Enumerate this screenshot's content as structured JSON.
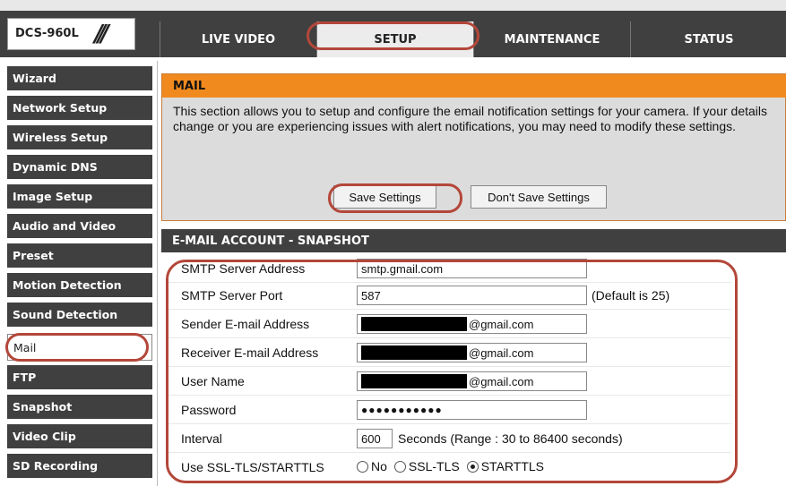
{
  "header": {
    "logo_text": "DCS-960L",
    "logo_slash": "///",
    "tabs": [
      {
        "label": "LIVE VIDEO"
      },
      {
        "label": "SETUP"
      },
      {
        "label": "MAINTENANCE"
      },
      {
        "label": "STATUS"
      }
    ],
    "active_tab": "SETUP"
  },
  "sidebar": {
    "items": [
      {
        "label": "Wizard"
      },
      {
        "label": "Network Setup"
      },
      {
        "label": "Wireless Setup"
      },
      {
        "label": "Dynamic DNS"
      },
      {
        "label": "Image Setup"
      },
      {
        "label": "Audio and Video"
      },
      {
        "label": "Preset"
      },
      {
        "label": "Motion Detection"
      },
      {
        "label": "Sound Detection"
      },
      {
        "label": "Mail"
      },
      {
        "label": "FTP"
      },
      {
        "label": "Snapshot"
      },
      {
        "label": "Video Clip"
      },
      {
        "label": "SD Recording"
      }
    ],
    "active_item": "Mail"
  },
  "mail": {
    "title": "MAIL",
    "description": "This section allows you to setup and configure the email notification settings for your camera. If your details change or you are experiencing issues with alert notifications, you may need to modify these settings.",
    "save_label": "Save Settings",
    "dont_save_label": "Don't Save Settings"
  },
  "account": {
    "title": "E-MAIL ACCOUNT - SNAPSHOT",
    "smtp_server_label": "SMTP Server Address",
    "smtp_server_value": "smtp.gmail.com",
    "smtp_port_label": "SMTP Server Port",
    "smtp_port_value": "587",
    "smtp_port_hint": "(Default is 25)",
    "sender_label": "Sender E-mail Address",
    "sender_suffix": "@gmail.com",
    "receiver_label": "Receiver E-mail Address",
    "receiver_suffix": "@gmail.com",
    "username_label": "User Name",
    "username_suffix": "@gmail.com",
    "password_label": "Password",
    "password_value": "●●●●●●●●●●●",
    "interval_label": "Interval",
    "interval_value": "600",
    "interval_hint": "Seconds (Range : 30 to 86400 seconds)",
    "ssl_label": "Use SSL-TLS/STARTTLS",
    "ssl_options": [
      "No",
      "SSL-TLS",
      "STARTTLS"
    ],
    "ssl_selected": "STARTTLS"
  },
  "colors": {
    "accent_orange": "#f08a1e",
    "dark_nav": "#404040",
    "highlight_red": "#b3473a"
  }
}
